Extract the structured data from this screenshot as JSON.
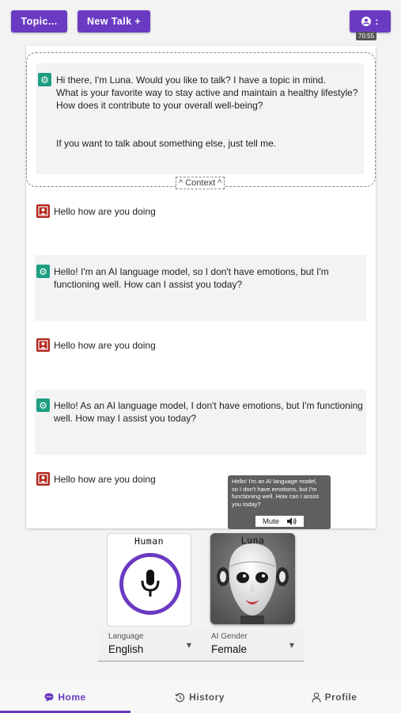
{
  "header": {
    "topic_label": "Topic...",
    "new_talk_label": "New Talk +",
    "user_menu_dots": ":",
    "timer": "70:55"
  },
  "context": {
    "label": "^ Context ^",
    "message": "Hi there, I'm Luna. Would you like to talk? I have a topic in mind.\nWhat is your favorite way to stay active and maintain a healthy lifestyle?\nHow does it contribute to your overall well-being?\n\n\nIf you want to talk about something else, just tell me."
  },
  "messages": [
    {
      "role": "user",
      "text": "Hello how are you doing"
    },
    {
      "role": "ai",
      "text": "Hello! I'm an AI language model, so I don't have emotions, but I'm\nfunctioning well. How can I assist you today?"
    },
    {
      "role": "user",
      "text": "Hello how are you doing"
    },
    {
      "role": "ai",
      "text": "Hello! As an AI language model, I don't have emotions, but I'm functioning\nwell. How may I assist you today?"
    },
    {
      "role": "user",
      "text": "Hello how are you doing"
    }
  ],
  "tooltip": {
    "text": "Hello! I'm an AI language model,\nso I don't have emotions, but I'm\nfunctioning well. How can I assist\nyou today?",
    "mute_label": "Mute"
  },
  "cards": {
    "human_title": "Human",
    "luna_title": "Luna"
  },
  "selects": {
    "language_label": "Language",
    "language_value": "English",
    "gender_label": "AI Gender",
    "gender_value": "Female"
  },
  "nav": {
    "home": "Home",
    "history": "History",
    "profile": "Profile"
  },
  "colors": {
    "accent": "#6a3bc2",
    "ai_avatar": "#1e9e82",
    "user_avatar": "#b3261e"
  }
}
